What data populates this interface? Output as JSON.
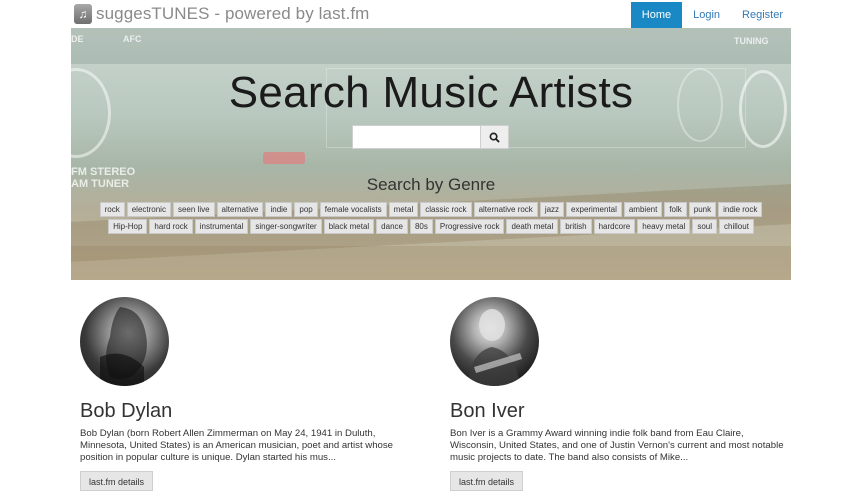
{
  "navbar": {
    "brand": "suggesTUNES - powered by last.fm",
    "links": [
      "Home",
      "Login",
      "Register"
    ],
    "active": "Home"
  },
  "hero": {
    "title": "Search Music Artists",
    "search_placeholder": "",
    "genre_title": "Search by Genre",
    "decor_text": [
      "DE",
      "AFC",
      "FM STEREO",
      "AM TUNER",
      "TUNING"
    ],
    "genres_row1": [
      "rock",
      "electronic",
      "seen live",
      "alternative",
      "indie",
      "pop",
      "female vocalists",
      "metal",
      "classic rock",
      "alternative rock",
      "jazz",
      "experimental",
      "ambient",
      "folk",
      "punk",
      "indie rock"
    ],
    "genres_row2": [
      "Hip-Hop",
      "hard rock",
      "instrumental",
      "singer-songwriter",
      "black metal",
      "dance",
      "80s",
      "Progressive rock",
      "death metal",
      "british",
      "hardcore",
      "heavy metal",
      "soul",
      "chillout"
    ]
  },
  "artists": [
    {
      "name": "Bob Dylan",
      "bio": "Bob Dylan (born Robert Allen Zimmerman on May 24, 1941 in Duluth, Minnesota, United States) is an American musician, poet and artist whose position in popular culture is unique. Dylan started his mus...",
      "button": "last.fm details"
    },
    {
      "name": "Bon Iver",
      "bio": "Bon Iver is a Grammy Award winning indie folk band from Eau Claire, Wisconsin, United States, and one of Justin Vernon's current and most notable music projects to date. The band also consists of Mike...",
      "button": "last.fm details"
    }
  ],
  "colors": {
    "nav_active": "#1a88c4",
    "link": "#337ab7"
  }
}
